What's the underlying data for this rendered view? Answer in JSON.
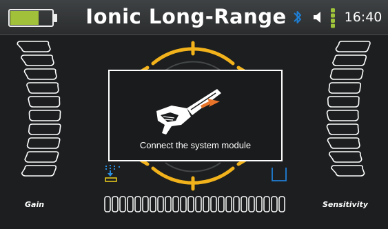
{
  "header": {
    "title": "Ionic Long-Range",
    "time": "16:40",
    "battery_level": 0.7,
    "battery_color": "#a2c13a"
  },
  "status_icons": [
    "bluetooth-icon",
    "volume-icon",
    "signal-level-icon"
  ],
  "colors": {
    "accent_yellow": "#f2b21b",
    "bluetooth_blue": "#1e7fd6",
    "level_green": "#9fc33a",
    "background": "#1c1e1f"
  },
  "left_scale": {
    "label": "Gain",
    "segments": 10
  },
  "right_scale": {
    "label": "Sensitivity",
    "segments": 10
  },
  "dialog": {
    "message": "Connect the system module"
  },
  "bottom_meter": {
    "segments": 24
  }
}
